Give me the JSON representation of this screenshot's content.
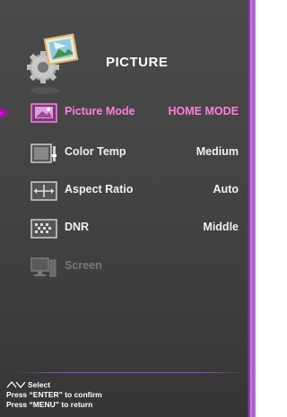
{
  "header": {
    "title": "PICTURE",
    "icon": "picture-settings-icon"
  },
  "menu": {
    "items": [
      {
        "label": "Picture Mode",
        "value": "HOME MODE",
        "icon": "picture-mode-icon",
        "state": "selected"
      },
      {
        "label": "Color Temp",
        "value": "Medium",
        "icon": "color-temp-icon",
        "state": "normal"
      },
      {
        "label": "Aspect Ratio",
        "value": "Auto",
        "icon": "aspect-ratio-icon",
        "state": "normal"
      },
      {
        "label": "DNR",
        "value": "Middle",
        "icon": "dnr-icon",
        "state": "normal"
      },
      {
        "label": "Screen",
        "value": "",
        "icon": "screen-icon",
        "state": "disabled"
      }
    ]
  },
  "hints": {
    "select": "Select",
    "confirm": "Press “ENTER” to confirm",
    "return": "Press “MENU” to return"
  },
  "colors": {
    "accent": "#ff7fd8",
    "panel": "#444444",
    "edge": "#9a48b8"
  }
}
